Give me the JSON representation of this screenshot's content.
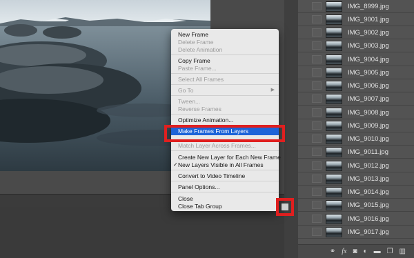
{
  "context_menu": {
    "items": [
      {
        "label": "New Frame",
        "enabled": true
      },
      {
        "label": "Delete Frame",
        "enabled": false
      },
      {
        "label": "Delete Animation",
        "enabled": false
      },
      {
        "label": "Copy Frame",
        "enabled": true
      },
      {
        "label": "Paste Frame...",
        "enabled": false
      },
      {
        "label": "Select All Frames",
        "enabled": false
      },
      {
        "label": "Go To",
        "enabled": false,
        "submenu": true
      },
      {
        "label": "Tween...",
        "enabled": false
      },
      {
        "label": "Reverse Frames",
        "enabled": false
      },
      {
        "label": "Optimize Animation...",
        "enabled": true
      },
      {
        "label": "Make Frames From Layers",
        "enabled": true,
        "highlighted": true
      },
      {
        "label": "Match Layer Across Frames...",
        "enabled": false
      },
      {
        "label": "Create New Layer for Each New Frame",
        "enabled": true
      },
      {
        "label": "New Layers Visible in All Frames",
        "enabled": true,
        "checked": true
      },
      {
        "label": "Convert to Video Timeline",
        "enabled": true
      },
      {
        "label": "Panel Options...",
        "enabled": true
      },
      {
        "label": "Close",
        "enabled": true
      },
      {
        "label": "Close Tab Group",
        "enabled": true
      }
    ],
    "check_glyph": "✓",
    "submenu_glyph": "▶"
  },
  "layers": [
    "IMG_8999.jpg",
    "IMG_9001.jpg",
    "IMG_9002.jpg",
    "IMG_9003.jpg",
    "IMG_9004.jpg",
    "IMG_9005.jpg",
    "IMG_9006.jpg",
    "IMG_9007.jpg",
    "IMG_9008.jpg",
    "IMG_9009.jpg",
    "IMG_9010.jpg",
    "IMG_9011.jpg",
    "IMG_9012.jpg",
    "IMG_9013.jpg",
    "IMG_9014.jpg",
    "IMG_9015.jpg",
    "IMG_9016.jpg",
    "IMG_9017.jpg"
  ],
  "layer_footer_icons": [
    "link-icon",
    "fx-icon",
    "mask-icon",
    "adjustment-icon",
    "folder-icon",
    "new-layer-icon",
    "trash-icon"
  ],
  "colors": {
    "highlight": "#1d64d8",
    "annotation": "#e01f1f",
    "menu_bg": "#e9e9e9"
  }
}
